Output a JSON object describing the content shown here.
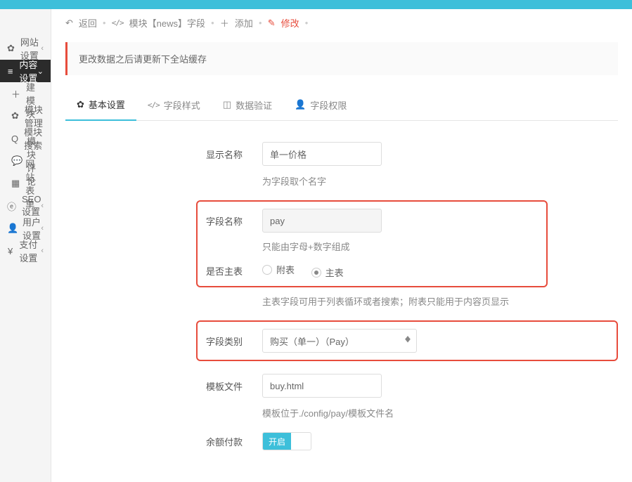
{
  "sidebar": {
    "site": "网站设置",
    "content": "内容设置",
    "create_module": "创建模块",
    "module_manage": "模块管理",
    "module_search": "模块搜索",
    "module_comment": "模块评论",
    "site_form": "网站表单",
    "seo": "SEO设置",
    "user": "用户设置",
    "pay": "支付设置"
  },
  "crumbs": {
    "back": "返回",
    "module": "模块【news】字段",
    "add": "添加",
    "edit": "修改"
  },
  "alert": "更改数据之后请更新下全站缓存",
  "tabs": {
    "basic": "基本设置",
    "style": "字段样式",
    "valid": "数据验证",
    "perm": "字段权限"
  },
  "form": {
    "display_name_lbl": "显示名称",
    "display_name_val": "单一价格",
    "display_name_hint": "为字段取个名字",
    "field_name_lbl": "字段名称",
    "field_name_val": "pay",
    "field_name_hint": "只能由字母+数字组成",
    "is_main_lbl": "是否主表",
    "aux_table": "附表",
    "main_table": "主表",
    "is_main_hint": "主表字段可用于列表循环或者搜索；附表只能用于内容页显示",
    "field_type_lbl": "字段类别",
    "field_type_val": "购买（单一）（Pay）",
    "tpl_lbl": "模板文件",
    "tpl_val": "buy.html",
    "tpl_hint": "模板位于./config/pay/模板文件名",
    "balance_lbl": "余额付款",
    "on": "开启"
  }
}
